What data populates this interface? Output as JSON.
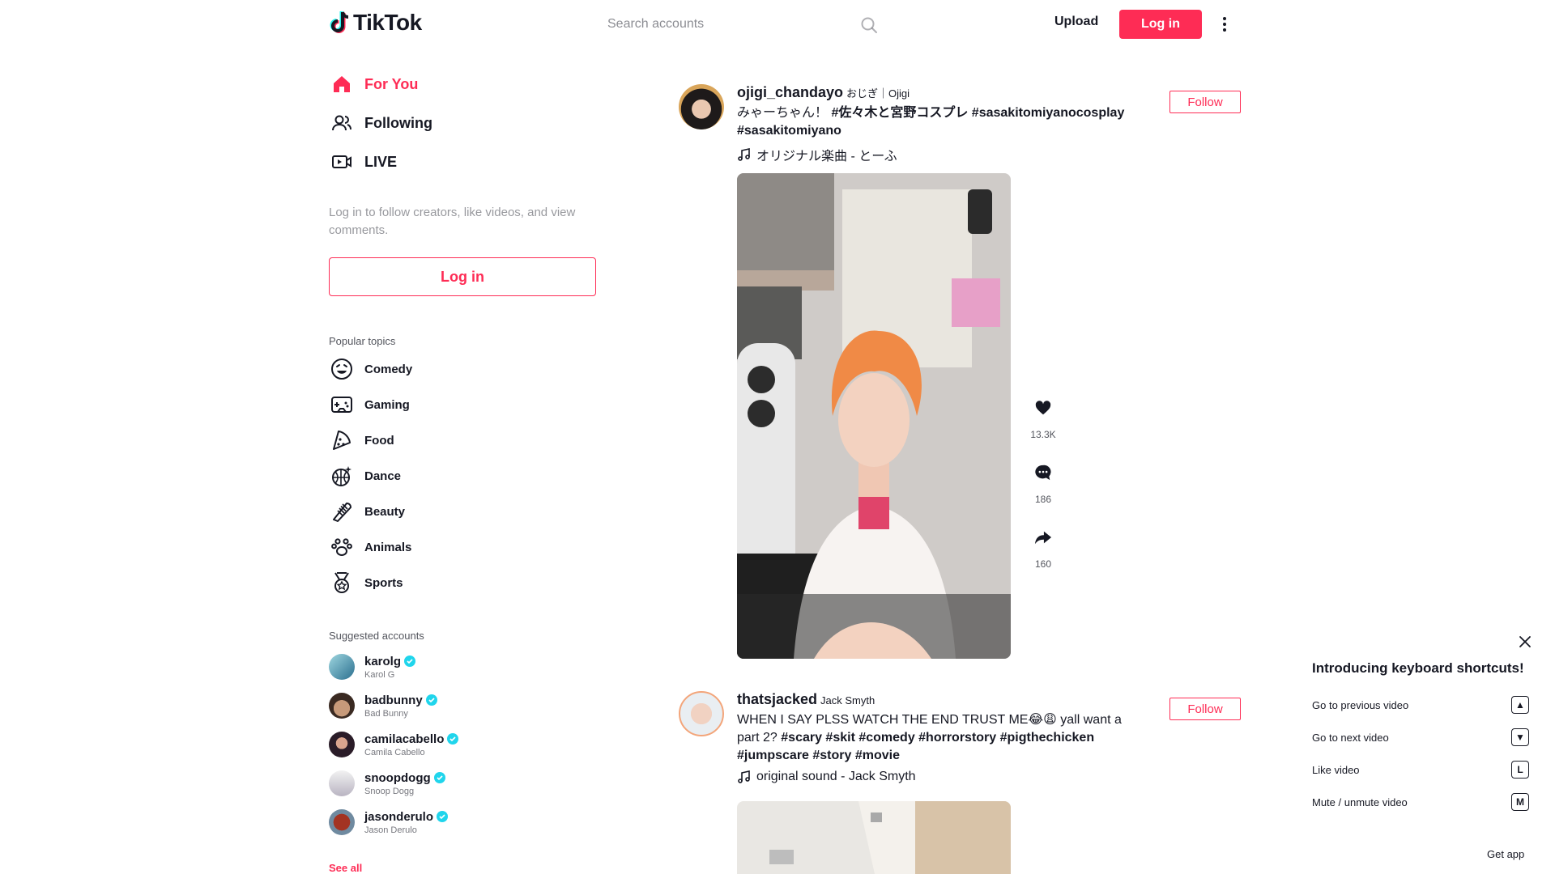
{
  "header": {
    "logo_text": "TikTok",
    "search_placeholder": "Search accounts",
    "upload_label": "Upload",
    "login_label": "Log in",
    "accent_color": "#fe2c55"
  },
  "sidebar": {
    "nav": [
      {
        "label": "For You",
        "icon": "home-icon",
        "active": true
      },
      {
        "label": "Following",
        "icon": "users-icon",
        "active": false
      },
      {
        "label": "LIVE",
        "icon": "live-icon",
        "active": false
      }
    ],
    "login_hint": "Log in to follow creators, like videos, and view comments.",
    "login_button": "Log in",
    "popular_title": "Popular topics",
    "topics": [
      {
        "label": "Comedy",
        "icon": "smile-icon"
      },
      {
        "label": "Gaming",
        "icon": "gamepad-icon"
      },
      {
        "label": "Food",
        "icon": "pizza-icon"
      },
      {
        "label": "Dance",
        "icon": "disco-ball-icon"
      },
      {
        "label": "Beauty",
        "icon": "comb-icon"
      },
      {
        "label": "Animals",
        "icon": "paw-icon"
      },
      {
        "label": "Sports",
        "icon": "medal-icon"
      }
    ],
    "suggested_title": "Suggested accounts",
    "accounts": [
      {
        "username": "karolg",
        "nickname": "Karol G"
      },
      {
        "username": "badbunny",
        "nickname": "Bad Bunny"
      },
      {
        "username": "camilacabello",
        "nickname": "Camila Cabello"
      },
      {
        "username": "snoopdogg",
        "nickname": "Snoop Dogg"
      },
      {
        "username": "jasonderulo",
        "nickname": "Jason Derulo"
      }
    ],
    "see_all": "See all"
  },
  "posts": [
    {
      "username": "ojigi_chandayo",
      "nickname": "おじぎ｜Ojigi",
      "desc_text": "みゃーちゃん！ ",
      "tags": "#佐々木と宮野コスプレ #sasakitomiyanocosplay #sasakitomiyano",
      "music": "オリジナル楽曲 - とーふ",
      "follow_label": "Follow",
      "likes": "13.3K",
      "comments": "186",
      "shares": "160"
    },
    {
      "username": "thatsjacked",
      "nickname": "Jack Smyth",
      "desc_text": "WHEN I SAY PLSS WATCH THE END TRUST ME😂😩 yall want a part 2? ",
      "tags": "#scary #skit #comedy #horrorstory #pigthechicken #jumpscare #story #movie",
      "music": "original sound - Jack Smyth",
      "follow_label": "Follow"
    }
  ],
  "shortcuts": {
    "title": "Introducing keyboard shortcuts!",
    "items": [
      {
        "label": "Go to previous video",
        "key": "▲"
      },
      {
        "label": "Go to next video",
        "key": "▼"
      },
      {
        "label": "Like video",
        "key": "L"
      },
      {
        "label": "Mute / unmute video",
        "key": "M"
      }
    ],
    "get_app": "Get app"
  }
}
